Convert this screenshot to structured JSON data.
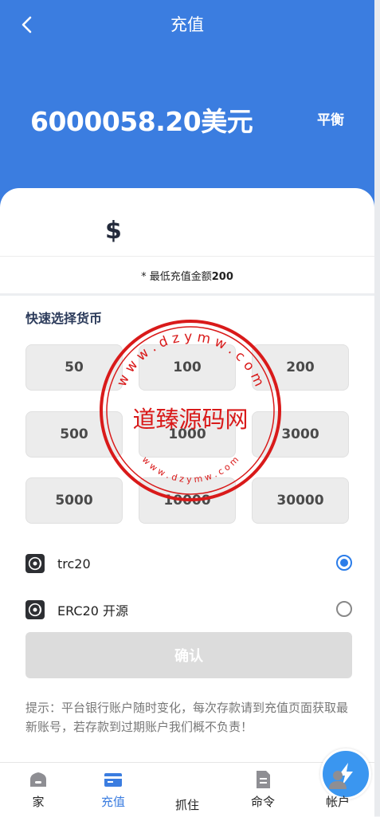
{
  "header": {
    "title": "充值",
    "balance": "6000058.20美元",
    "balance_label": "平衡"
  },
  "amount": {
    "currency_symbol": "$",
    "value": "",
    "min_note_prefix": "* 最低充值金额",
    "min_amount": "200"
  },
  "quick_select": {
    "title": "快速选择货币",
    "amounts": [
      "50",
      "100",
      "200",
      "500",
      "1000",
      "3000",
      "5000",
      "10000",
      "30000"
    ]
  },
  "payment_methods": [
    {
      "label": "trc20",
      "selected": true
    },
    {
      "label": "ERC20 开源",
      "selected": false
    }
  ],
  "confirm_label": "确认",
  "tip": "提示：平台银行账户随时变化，每次存款请到充值页面获取最新账号，若存款到过期账户我们概不负责！",
  "watermark": {
    "text": "道臻源码网",
    "ring_text": "w w w . d z y m w . c o m"
  },
  "tabbar": {
    "items": [
      "家",
      "充值",
      "抓住",
      "命令",
      "帐户"
    ],
    "active_index": 1
  },
  "colors": {
    "primary": "#3b7de0",
    "tab_center": "#3a96f0",
    "watermark": "#d91a1a"
  }
}
